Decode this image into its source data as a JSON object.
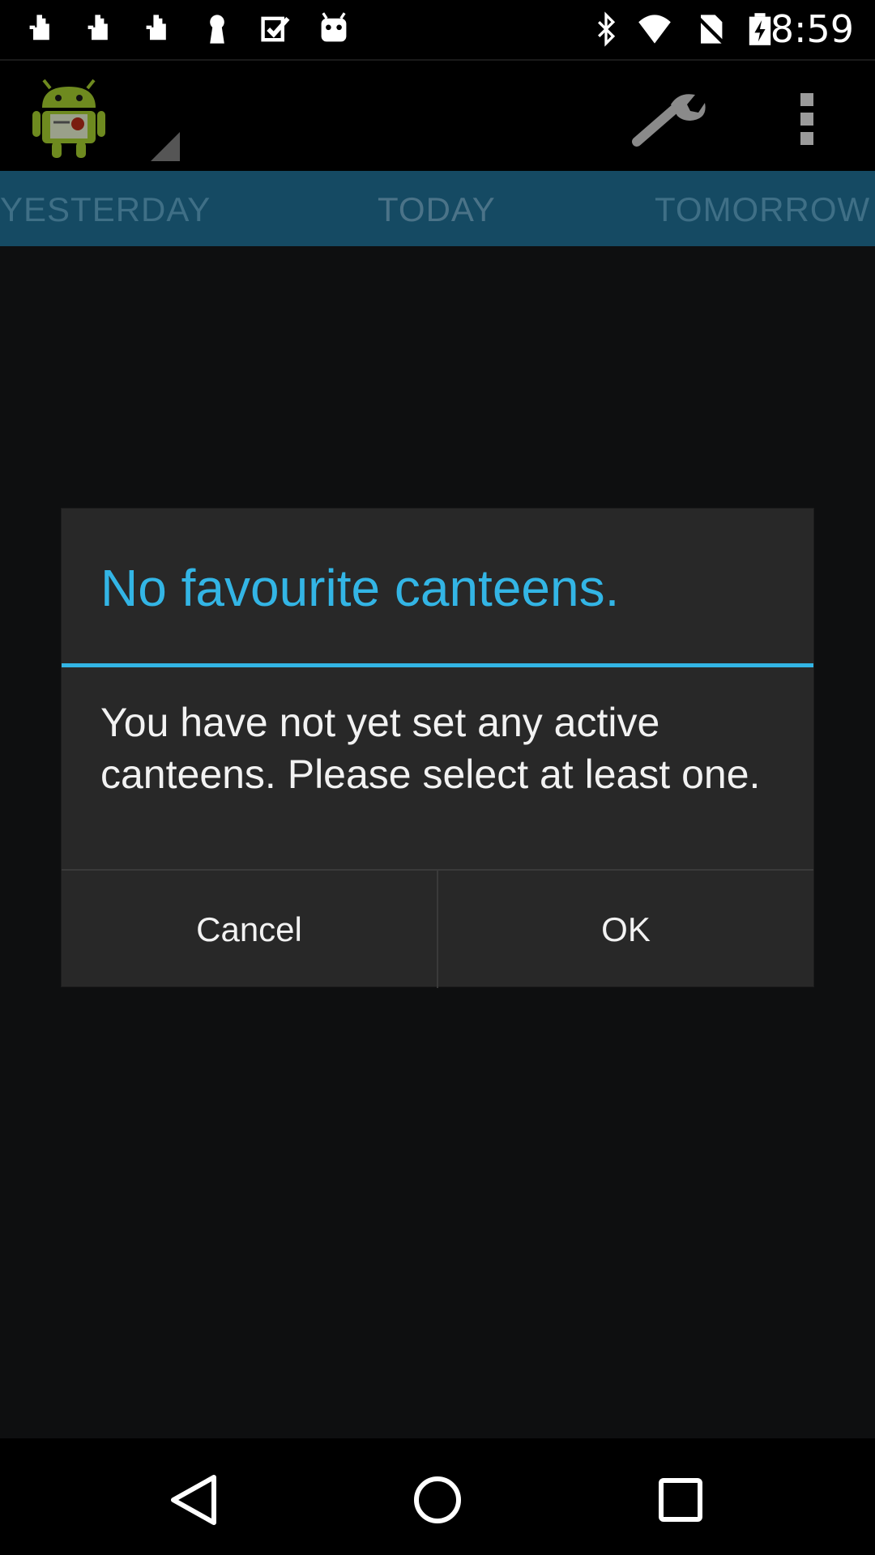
{
  "status_bar": {
    "time": "8:59",
    "left_icons": [
      "touch-gesture-icon",
      "touch-gesture-icon",
      "touch-gesture-icon",
      "keyhole-icon",
      "checkbox-icon",
      "android-robot-icon"
    ],
    "right_icons": [
      "bluetooth-icon",
      "wifi-icon",
      "no-sim-icon",
      "battery-charging-icon"
    ]
  },
  "action_bar": {
    "logo_icon": "android-canteen-logo-icon",
    "settings_icon": "wrench-icon",
    "overflow_icon": "overflow-menu-icon"
  },
  "tabs": [
    {
      "label": "YESTERDAY"
    },
    {
      "label": "TODAY"
    },
    {
      "label": "TOMORROW"
    }
  ],
  "dialog": {
    "title": "No favourite canteens.",
    "message": "You have not yet set any active canteens. Please select at least one.",
    "cancel_label": "Cancel",
    "ok_label": "OK",
    "accent_color": "#33b5e5"
  },
  "nav_bar": {
    "back_icon": "back-triangle-icon",
    "home_icon": "home-circle-icon",
    "recents_icon": "recents-square-icon"
  },
  "colors": {
    "tab_strip": "#154a63",
    "background": "#0e0f10",
    "dialog_bg": "#282828"
  }
}
